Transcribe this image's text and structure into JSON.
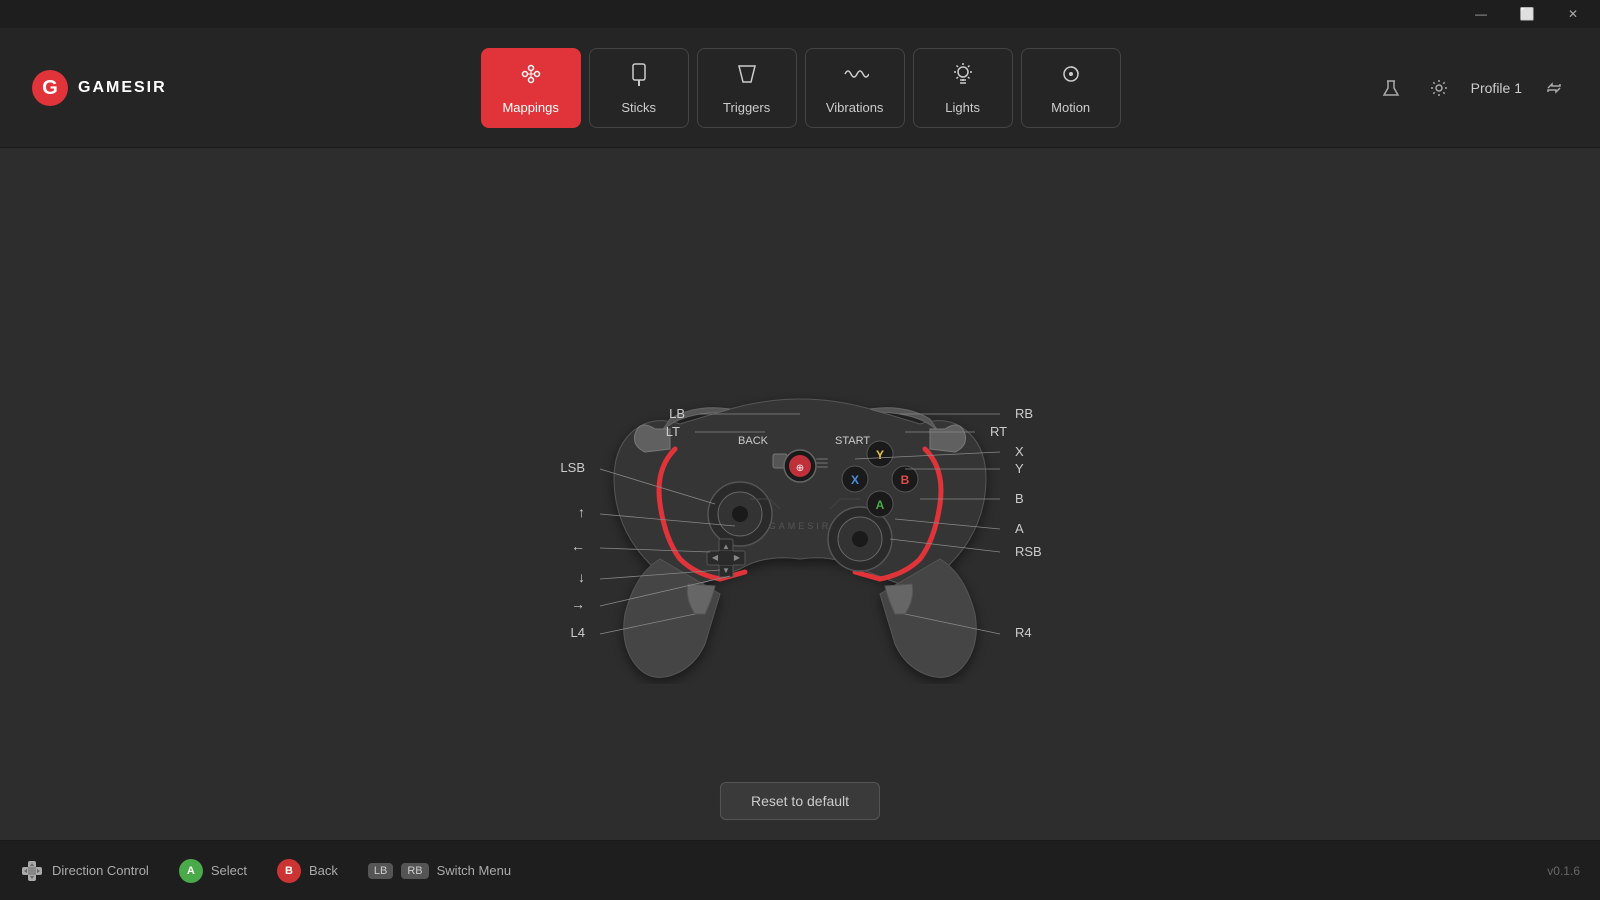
{
  "titlebar": {
    "minimize_label": "—",
    "maximize_label": "⬜",
    "close_label": "✕"
  },
  "logo": {
    "text": "GAMESIR"
  },
  "nav": {
    "tabs": [
      {
        "id": "mappings",
        "label": "Mappings",
        "icon": "🎮",
        "active": true
      },
      {
        "id": "sticks",
        "label": "Sticks",
        "icon": "🕹",
        "active": false
      },
      {
        "id": "triggers",
        "label": "Triggers",
        "icon": "◣",
        "active": false
      },
      {
        "id": "vibrations",
        "label": "Vibrations",
        "icon": "〰",
        "active": false
      },
      {
        "id": "lights",
        "label": "Lights",
        "icon": "💡",
        "active": false
      },
      {
        "id": "motion",
        "label": "Motion",
        "icon": "⚙",
        "active": false
      }
    ]
  },
  "header_right": {
    "profile_label": "Profile 1"
  },
  "controller": {
    "labels_left": {
      "LB": "LB",
      "LT": "LT",
      "LSB": "LSB",
      "up": "↑",
      "left": "←",
      "down": "↓",
      "right": "→",
      "L4": "L4",
      "BACK": "BACK"
    },
    "labels_right": {
      "RB": "RB",
      "RT": "RT",
      "X": "X",
      "Y": "Y",
      "B": "B",
      "A": "A",
      "RSB": "RSB",
      "R4": "R4",
      "START": "START"
    }
  },
  "reset_button": {
    "label": "Reset to default"
  },
  "bottom_bar": {
    "direction_control_label": "Direction Control",
    "select_label": "Select",
    "select_icon": "A",
    "back_label": "Back",
    "back_icon": "B",
    "switch_menu_label": "Switch Menu",
    "lb_label": "LB",
    "rb_label": "RB",
    "version": "v0.1.6"
  }
}
